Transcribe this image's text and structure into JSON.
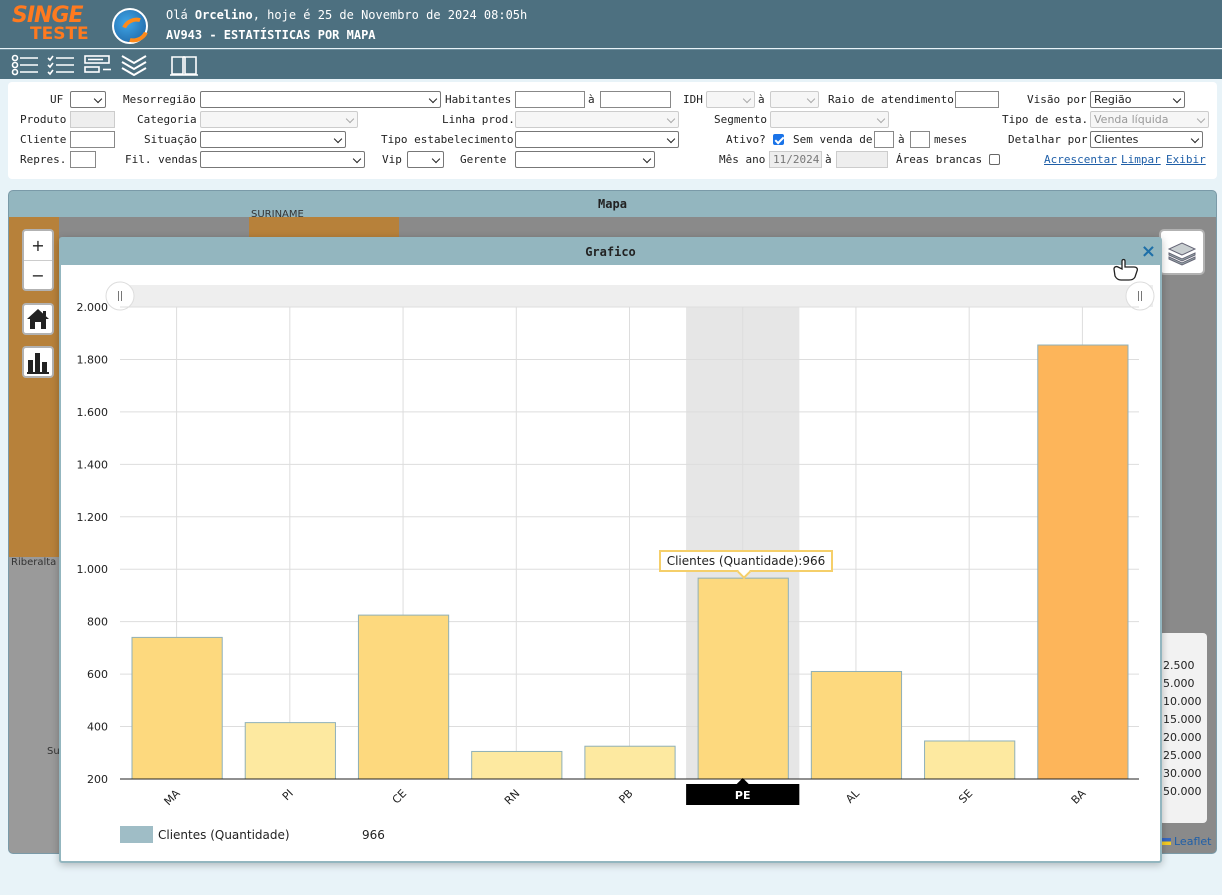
{
  "header": {
    "logo_top": "SINGE",
    "logo_bottom": "TESTE",
    "greeting_prefix": "Olá ",
    "user_name": "Orcelino",
    "greeting_suffix": ", hoje é 25 de Novembro de 2024 08:05h",
    "page_title": "AV943 - ESTATÍSTICAS POR MAPA"
  },
  "toolbar": {
    "icons": [
      "list-icon",
      "checklist-icon",
      "form-icon",
      "collapse-icon",
      "book-icon"
    ]
  },
  "filters": {
    "uf_label": "UF",
    "mesorregiao_label": "Mesorregião",
    "habitantes_label": "Habitantes",
    "a_label": "à",
    "idh_label": "IDH",
    "raio_label": "Raio de atendimento",
    "visao_label": "Visão por",
    "visao_value": "Região",
    "produto_label": "Produto",
    "categoria_label": "Categoria",
    "linha_label": "Linha prod.",
    "segmento_label": "Segmento",
    "tipo_esta_label": "Tipo de esta.",
    "tipo_esta_value": "Venda líquida",
    "cliente_label": "Cliente",
    "situacao_label": "Situação",
    "tipo_estab_label": "Tipo estabelecimento",
    "ativo_label": "Ativo?",
    "sem_venda_label": "Sem venda de",
    "meses_label": "meses",
    "detalhar_label": "Detalhar por",
    "detalhar_value": "Clientes",
    "repres_label": "Repres.",
    "fil_vendas_label": "Fil. vendas",
    "vip_label": "Vip",
    "gerente_label": "Gerente",
    "mes_ano_label": "Mês ano",
    "mes_ano_value": "11/2024",
    "areas_brancas_label": "Áreas brancas",
    "acrescentar_link": "Acrescentar",
    "limpar_link": "Limpar",
    "exibir_link": "Exibir"
  },
  "map": {
    "title": "Mapa",
    "zoom_in": "+",
    "zoom_out": "−",
    "labels": [
      "SURINAME",
      "Riberalta",
      "Su"
    ],
    "legend_items": [
      "2.500",
      "5.000",
      "10.000",
      "15.000",
      "20.000",
      "25.000",
      "30.000",
      "50.000"
    ],
    "attribution": "Leaflet"
  },
  "modal": {
    "title": "Grafico",
    "close_label": "×",
    "tooltip_label": "Clientes (Quantidade):966",
    "legend_name": "Clientes (Quantidade)",
    "legend_value": "966"
  },
  "chart_data": {
    "type": "bar",
    "categories": [
      "MA",
      "PI",
      "CE",
      "RN",
      "PB",
      "PE",
      "AL",
      "SE",
      "BA"
    ],
    "series": [
      {
        "name": "Clientes (Quantidade)",
        "values": [
          740,
          415,
          825,
          305,
          325,
          966,
          610,
          345,
          1855
        ]
      }
    ],
    "y_ticks": [
      "200",
      "400",
      "600",
      "800",
      "1.000",
      "1.200",
      "1.400",
      "1.600",
      "1.800",
      "2.000"
    ],
    "ylim": [
      200,
      2000
    ],
    "highlighted_category": "PE",
    "grid": true,
    "colors": {
      "bar_low": "#fde9a0",
      "bar_mid": "#fdd97e",
      "bar_high": "#fdb55a",
      "highlight_band": "#e6e6e6"
    }
  }
}
